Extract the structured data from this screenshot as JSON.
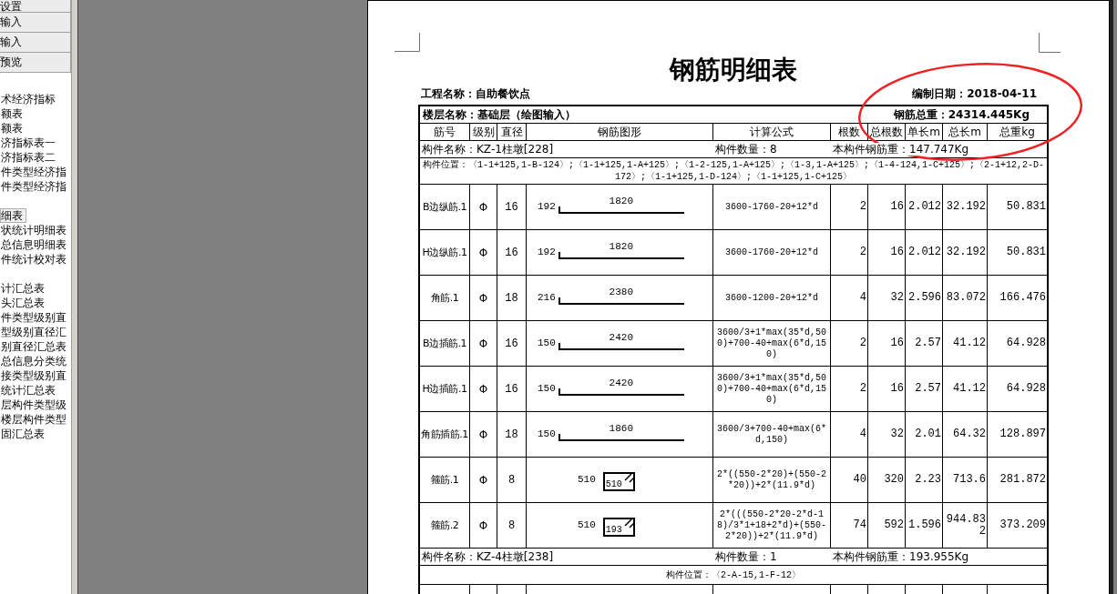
{
  "sidebar": {
    "tabs": [
      {
        "label": "设置",
        "selected": false
      },
      {
        "label": "输入",
        "selected": false
      },
      {
        "label": "输入",
        "selected": false
      },
      {
        "label": "预览",
        "selected": false
      }
    ],
    "groups": [
      {
        "items": [
          {
            "label": "术经济指标",
            "selected": false
          },
          {
            "label": "额表",
            "selected": false
          },
          {
            "label": "额表",
            "selected": false
          },
          {
            "label": "济指标表一",
            "selected": false
          },
          {
            "label": "济指标表二",
            "selected": false
          },
          {
            "label": "件类型经济指",
            "selected": false
          },
          {
            "label": "件类型经济指",
            "selected": false
          }
        ]
      },
      {
        "items": [
          {
            "label": "细表",
            "selected": true
          },
          {
            "label": "状统计明细表",
            "selected": false
          },
          {
            "label": "总信息明细表",
            "selected": false
          },
          {
            "label": "件统计校对表",
            "selected": false
          }
        ]
      },
      {
        "items": [
          {
            "label": "计汇总表",
            "selected": false
          },
          {
            "label": "头汇总表",
            "selected": false
          },
          {
            "label": "件类型级别直",
            "selected": false
          },
          {
            "label": "型级别直径汇",
            "selected": false
          },
          {
            "label": "别直径汇总表",
            "selected": false
          },
          {
            "label": "总信息分类统",
            "selected": false
          },
          {
            "label": "接类型级别直",
            "selected": false
          },
          {
            "label": "统计汇总表",
            "selected": false
          },
          {
            "label": "层构件类型级",
            "selected": false
          },
          {
            "label": "楼层构件类型",
            "selected": false
          },
          {
            "label": "固汇总表",
            "selected": false
          }
        ]
      }
    ]
  },
  "page": {
    "title": "钢筋明细表",
    "project": "工程名称：自助餐饮点",
    "date": "编制日期：2018-04-11",
    "floor": "楼层名称：基础层（绘图输入）",
    "total_weight": "钢筋总重：24314.445Kg",
    "columns": [
      "筋号",
      "级别",
      "直径",
      "钢筋图形",
      "计算公式",
      "根数",
      "总根数",
      "单长m",
      "总长m",
      "总重kg"
    ],
    "components": [
      {
        "name": "构件名称：KZ-1柱墩[228]",
        "count": "构件数量：8",
        "weight": "本构件钢筋重：147.747Kg",
        "position": "构件位置：〈1-1+125,1-B-124〉;〈1-1+125,1-A+125〉;〈1-2-125,1-A+125〉;〈1-3,1-A+125〉;〈1-4-124,1-C+125〉;〈2-1+12,2-D-172〉;〈1-1+125,1-D-124〉;〈1-1+125,1-C+125〉",
        "rows": [
          {
            "bar": "B边纵筋.1",
            "grade": "Φ",
            "diameter": "16",
            "shape": {
              "kind": "bent",
              "hook": "192",
              "length": "1820"
            },
            "formula": "3600-1760-20+12*d",
            "count": "2",
            "total_count": "16",
            "unit_length": "2.012",
            "total_length": "32.192",
            "weight": "50.831"
          },
          {
            "bar": "H边纵筋.1",
            "grade": "Φ",
            "diameter": "16",
            "shape": {
              "kind": "bent",
              "hook": "192",
              "length": "1820"
            },
            "formula": "3600-1760-20+12*d",
            "count": "2",
            "total_count": "16",
            "unit_length": "2.012",
            "total_length": "32.192",
            "weight": "50.831"
          },
          {
            "bar": "角筋.1",
            "grade": "Φ",
            "diameter": "18",
            "shape": {
              "kind": "bent",
              "hook": "216",
              "length": "2380"
            },
            "formula": "3600-1200-20+12*d",
            "count": "4",
            "total_count": "32",
            "unit_length": "2.596",
            "total_length": "83.072",
            "weight": "166.476"
          },
          {
            "bar": "B边插筋.1",
            "grade": "Φ",
            "diameter": "16",
            "shape": {
              "kind": "bent",
              "hook": "150",
              "length": "2420"
            },
            "formula": "3600/3+1*max(35*d,500)+700-40+max(6*d,150)",
            "count": "2",
            "total_count": "16",
            "unit_length": "2.57",
            "total_length": "41.12",
            "weight": "64.928"
          },
          {
            "bar": "H边插筋.1",
            "grade": "Φ",
            "diameter": "16",
            "shape": {
              "kind": "bent",
              "hook": "150",
              "length": "2420"
            },
            "formula": "3600/3+1*max(35*d,500)+700-40+max(6*d,150)",
            "count": "2",
            "total_count": "16",
            "unit_length": "2.57",
            "total_length": "41.12",
            "weight": "64.928"
          },
          {
            "bar": "角筋插筋.1",
            "grade": "Φ",
            "diameter": "18",
            "shape": {
              "kind": "bent",
              "hook": "150",
              "length": "1860"
            },
            "formula": "3600/3+700-40+max(6*d,150)",
            "count": "4",
            "total_count": "32",
            "unit_length": "2.01",
            "total_length": "64.32",
            "weight": "128.897"
          },
          {
            "bar": "箍筋.1",
            "grade": "Φ",
            "diameter": "8",
            "shape": {
              "kind": "stirrup",
              "side": "510",
              "inner": "510"
            },
            "formula": "2*((550-2*20)+(550-2*20))+2*(11.9*d)",
            "count": "40",
            "total_count": "320",
            "unit_length": "2.23",
            "total_length": "713.6",
            "weight": "281.872"
          },
          {
            "bar": "箍筋.2",
            "grade": "Φ",
            "diameter": "8",
            "shape": {
              "kind": "stirrup",
              "side": "510",
              "inner": "193"
            },
            "formula": "2*(((550-2*20-2*d-18)/3*1+18+2*d)+(550-2*20))+2*(11.9*d)",
            "count": "74",
            "total_count": "592",
            "unit_length": "1.596",
            "total_length": "944.832",
            "weight": "373.209"
          }
        ]
      },
      {
        "name": "构件名称：KZ-4柱墩[238]",
        "count": "构件数量：1",
        "weight": "本构件钢筋重：193.955Kg",
        "position": "构件位置：〈2-A-15,1-F-12〉"
      }
    ]
  }
}
